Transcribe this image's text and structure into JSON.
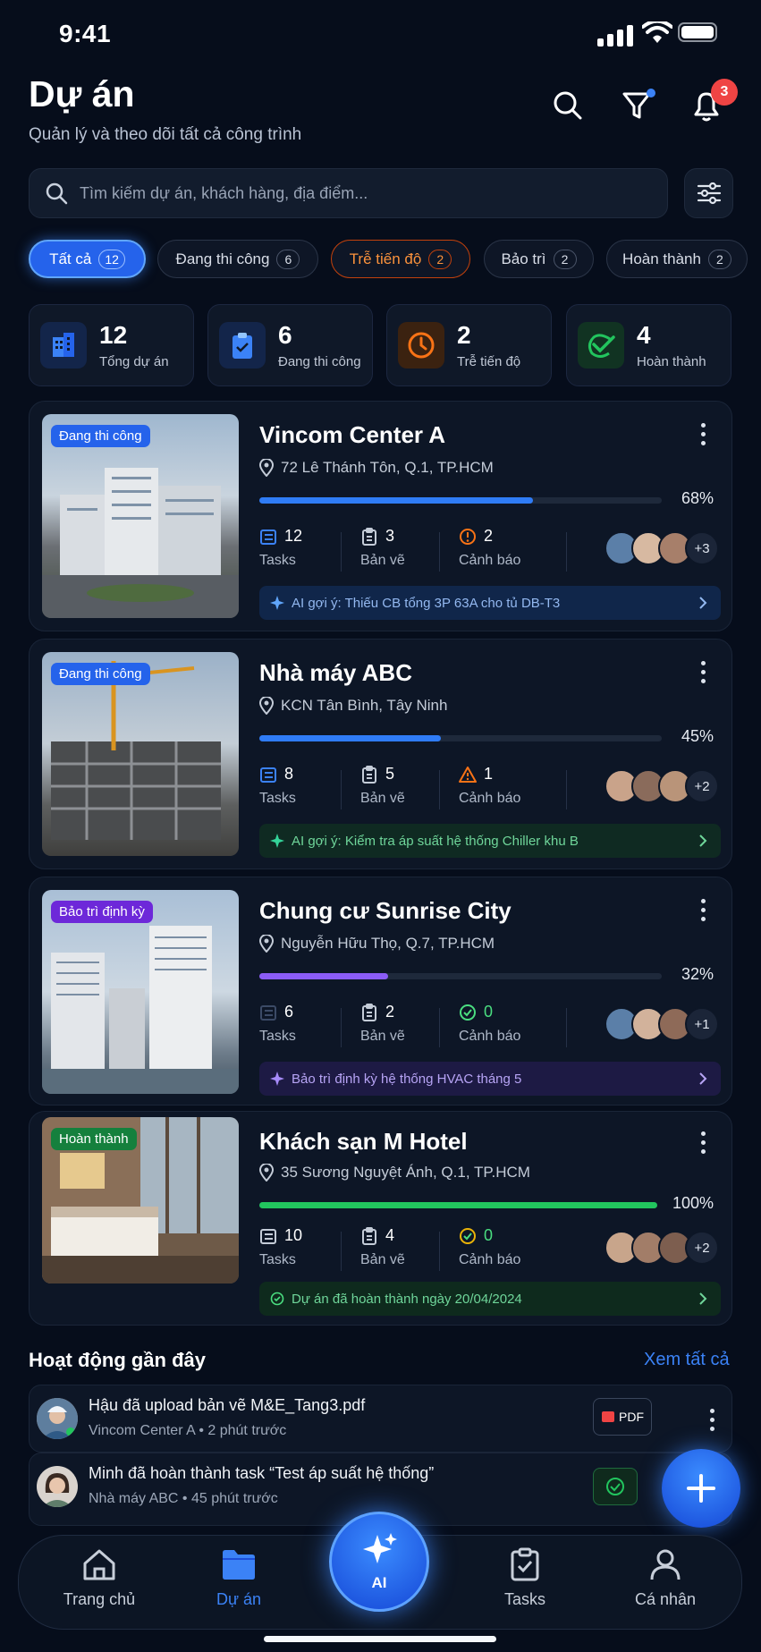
{
  "status_bar": {
    "time": "9:41"
  },
  "header": {
    "title": "Dự án",
    "subtitle": "Quản lý và theo dõi tất cả công trình",
    "notification_count": "3"
  },
  "search": {
    "placeholder": "Tìm kiếm dự án, khách hàng, địa điểm..."
  },
  "chips": [
    {
      "label": "Tất cả",
      "count": "12"
    },
    {
      "label": "Đang thi công",
      "count": "6"
    },
    {
      "label": "Trễ tiến độ",
      "count": "2"
    },
    {
      "label": "Bảo trì",
      "count": "2"
    },
    {
      "label": "Hoàn thành",
      "count": "2"
    }
  ],
  "stats": [
    {
      "value": "12",
      "label": "Tổng dự án",
      "icon": "building-icon",
      "color": "#3b82f6"
    },
    {
      "value": "6",
      "label": "Đang thi công",
      "icon": "clipboard-icon",
      "color": "#3b82f6"
    },
    {
      "value": "2",
      "label": "Trễ tiến độ",
      "icon": "clock-icon",
      "color": "#f97316"
    },
    {
      "value": "4",
      "label": "Hoàn thành",
      "icon": "check-icon",
      "color": "#22c55e"
    }
  ],
  "projects": [
    {
      "tag": "Đang thi công",
      "name": "Vincom Center A",
      "address": "72 Lê Thánh Tôn, Q.1, TP.HCM",
      "progress": 68,
      "progress_label": "68%",
      "tasks": "12",
      "tasks_label": "Tasks",
      "drawings": "3",
      "drawings_label": "Bản vẽ",
      "alerts": "2",
      "alerts_label": "Cảnh báo",
      "more": "+3",
      "hint": "AI gợi ý: Thiếu CB tổng 3P 63A cho tủ DB-T3",
      "color": "#2f7cf6"
    },
    {
      "tag": "Đang thi công",
      "name": "Nhà máy ABC",
      "address": "KCN Tân Bình, Tây Ninh",
      "progress": 45,
      "progress_label": "45%",
      "tasks": "8",
      "tasks_label": "Tasks",
      "drawings": "5",
      "drawings_label": "Bản vẽ",
      "alerts": "1",
      "alerts_label": "Cảnh báo",
      "more": "+2",
      "hint": "AI gợi ý: Kiểm tra áp suất hệ thống Chiller khu B",
      "color": "#2f7cf6"
    },
    {
      "tag": "Bảo trì định kỳ",
      "name": "Chung cư Sunrise City",
      "address": "Nguyễn Hữu Thọ, Q.7, TP.HCM",
      "progress": 32,
      "progress_label": "32%",
      "tasks": "6",
      "tasks_label": "Tasks",
      "drawings": "2",
      "drawings_label": "Bản vẽ",
      "alerts": "0",
      "alerts_label": "Cảnh báo",
      "more": "+1",
      "hint": "Bảo trì định kỳ hệ thống HVAC tháng 5",
      "color": "#8b5cf6"
    },
    {
      "tag": "Hoàn thành",
      "name": "Khách sạn M Hotel",
      "address": "35 Sương Nguyệt Ánh, Q.1, TP.HCM",
      "progress": 100,
      "progress_label": "100%",
      "tasks": "10",
      "tasks_label": "Tasks",
      "drawings": "4",
      "drawings_label": "Bản vẽ",
      "alerts": "0",
      "alerts_label": "Cảnh báo",
      "more": "+2",
      "hint": "Dự án đã hoàn thành ngày 20/04/2024",
      "color": "#22c55e"
    }
  ],
  "activity": {
    "title": "Hoạt động gần đây",
    "see_all": "Xem tất cả",
    "items": [
      {
        "text": "Hậu đã upload bản vẽ M&E_Tang3.pdf",
        "project": "Vincom Center A",
        "time": "2 phút trước",
        "badge": "PDF"
      },
      {
        "text": "Minh đã hoàn thành task “Test áp suất hệ thống”",
        "project": "Nhà máy ABC",
        "time": "45 phút trước"
      }
    ]
  },
  "nav": {
    "home": "Trang chủ",
    "projects": "Dự án",
    "ai": "AI",
    "tasks": "Tasks",
    "profile": "Cá nhân"
  }
}
